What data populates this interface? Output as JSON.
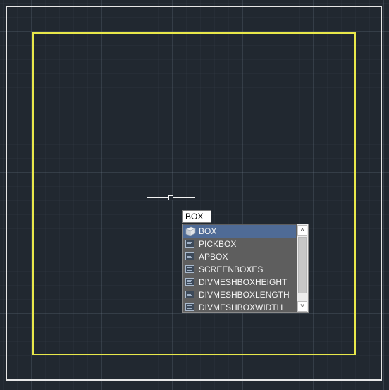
{
  "command_input": {
    "value": "BOX"
  },
  "autocomplete": {
    "selected_index": 0,
    "items": [
      {
        "label": "BOX",
        "icon": "box-3d-icon"
      },
      {
        "label": "PICKBOX",
        "icon": "system-variable-icon"
      },
      {
        "label": "APBOX",
        "icon": "system-variable-icon"
      },
      {
        "label": "SCREENBOXES",
        "icon": "system-variable-icon"
      },
      {
        "label": "DIVMESHBOXHEIGHT",
        "icon": "system-variable-icon"
      },
      {
        "label": "DIVMESHBOXLENGTH",
        "icon": "system-variable-icon"
      },
      {
        "label": "DIVMESHBOXWIDTH",
        "icon": "system-variable-icon"
      }
    ],
    "scroll_up_glyph": "˄",
    "scroll_down_glyph": "˅"
  },
  "colors": {
    "background": "#212830",
    "outer_border": "#e6e6e6",
    "yellow_rectangle": "#e8e84a",
    "crosshair": "#f2f2f2",
    "selected_item": "#4f6b96",
    "list_background": "#5e5e5e"
  }
}
